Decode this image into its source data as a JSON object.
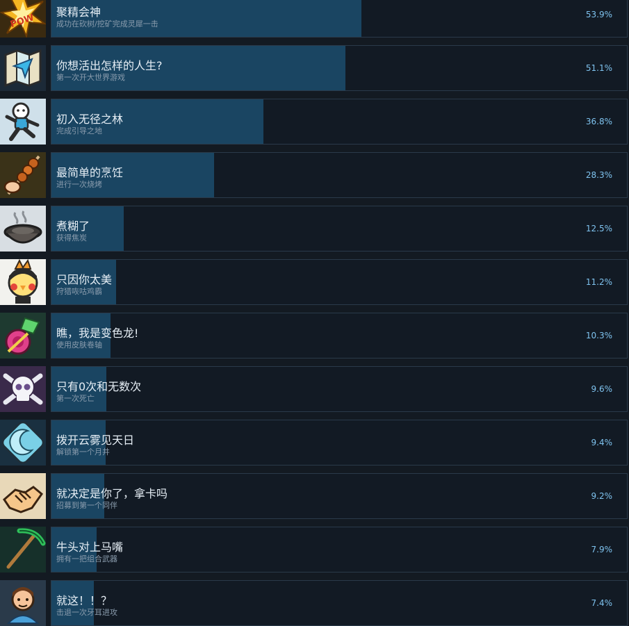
{
  "achievements": [
    {
      "title": "聚精会神",
      "description": "成功在砍树/挖矿完成灵犀一击",
      "percent": "53.9%",
      "rate": 53.9,
      "icon": "pow-burst-icon"
    },
    {
      "title": "你想活出怎样的人生?",
      "description": "第一次开大世界游戏",
      "percent": "51.1%",
      "rate": 51.1,
      "icon": "world-map-icon"
    },
    {
      "title": "初入无径之林",
      "description": "完成引导之地",
      "percent": "36.8%",
      "rate": 36.8,
      "icon": "running-character-icon"
    },
    {
      "title": "最简单的烹饪",
      "description": "进行一次烧烤",
      "percent": "28.3%",
      "rate": 28.3,
      "icon": "meat-skewer-icon"
    },
    {
      "title": "煮糊了",
      "description": "获得焦炭",
      "percent": "12.5%",
      "rate": 12.5,
      "icon": "burnt-pot-icon"
    },
    {
      "title": "只因你太美",
      "description": "狩猎咴咕鸡霸",
      "percent": "11.2%",
      "rate": 11.2,
      "icon": "chicken-boss-icon"
    },
    {
      "title": "瞧，我是变色龙!",
      "description": "使用皮肤卷轴",
      "percent": "10.3%",
      "rate": 10.3,
      "icon": "skin-scroll-icon"
    },
    {
      "title": "只有0次和无数次",
      "description": "第一次死亡",
      "percent": "9.6%",
      "rate": 9.6,
      "icon": "skull-crossbones-icon"
    },
    {
      "title": "拨开云雾见天日",
      "description": "解锁第一个月井",
      "percent": "9.4%",
      "rate": 9.4,
      "icon": "moon-well-icon"
    },
    {
      "title": "就决定是你了，拿卡吗",
      "description": "招募到第一个同伴",
      "percent": "9.2%",
      "rate": 9.2,
      "icon": "handshake-icon"
    },
    {
      "title": "牛头对上马嘴",
      "description": "拥有一把组合武器",
      "percent": "7.9%",
      "rate": 7.9,
      "icon": "pickaxe-icon"
    },
    {
      "title": "就这！！？",
      "description": "击退一次牙耳进攻",
      "percent": "7.4%",
      "rate": 7.4,
      "icon": "raid-villager-icon"
    }
  ]
}
